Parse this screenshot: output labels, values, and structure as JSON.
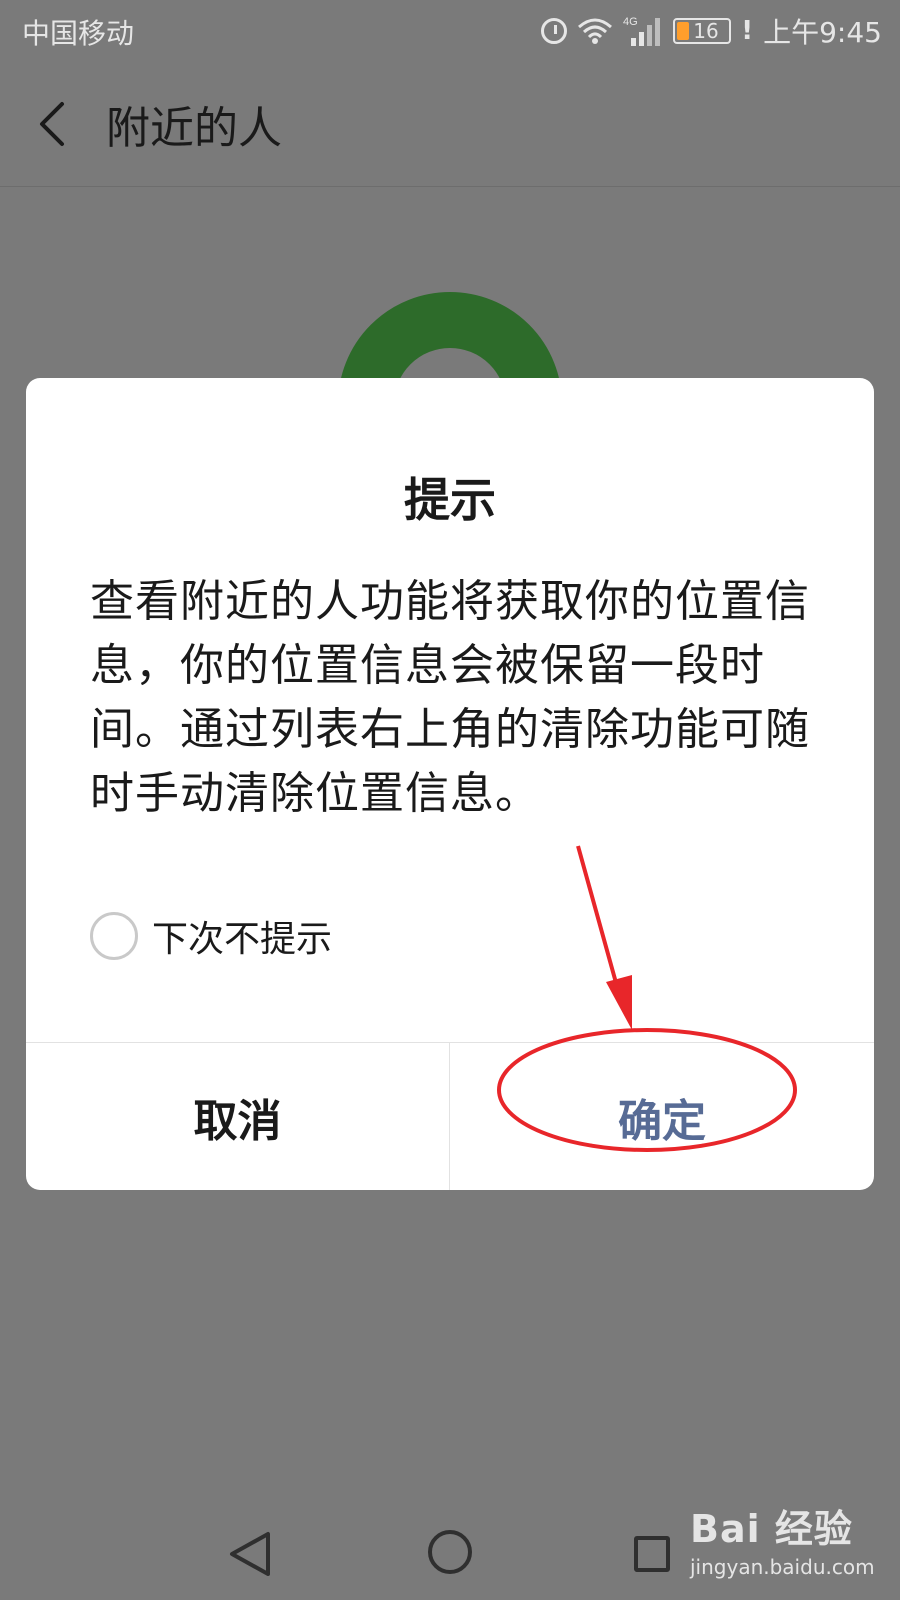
{
  "status_bar": {
    "carrier": "中国移动",
    "network": "4G",
    "battery_level": "16",
    "battery_warning": "!",
    "time": "上午9:45"
  },
  "app_bar": {
    "title": "附近的人"
  },
  "dialog": {
    "title": "提示",
    "message": "查看附近的人功能将获取你的位置信息，你的位置信息会被保留一段时间。通过列表右上角的清除功能可随时手动清除位置信息。",
    "checkbox_label": "下次不提示",
    "cancel_label": "取消",
    "confirm_label": "确定"
  },
  "watermark": {
    "logo_text": "Bai 经验",
    "url": "jingyan.baidu.com"
  },
  "colors": {
    "overlay": "#7a7a7a",
    "ring": "#2d6b2a",
    "confirm_text": "#576b95",
    "annotation": "#e8262a"
  },
  "icons": [
    "back-icon",
    "alarm-icon",
    "wifi-icon",
    "signal-icon",
    "battery-icon",
    "nav-back-icon",
    "nav-home-icon",
    "nav-recent-icon"
  ]
}
